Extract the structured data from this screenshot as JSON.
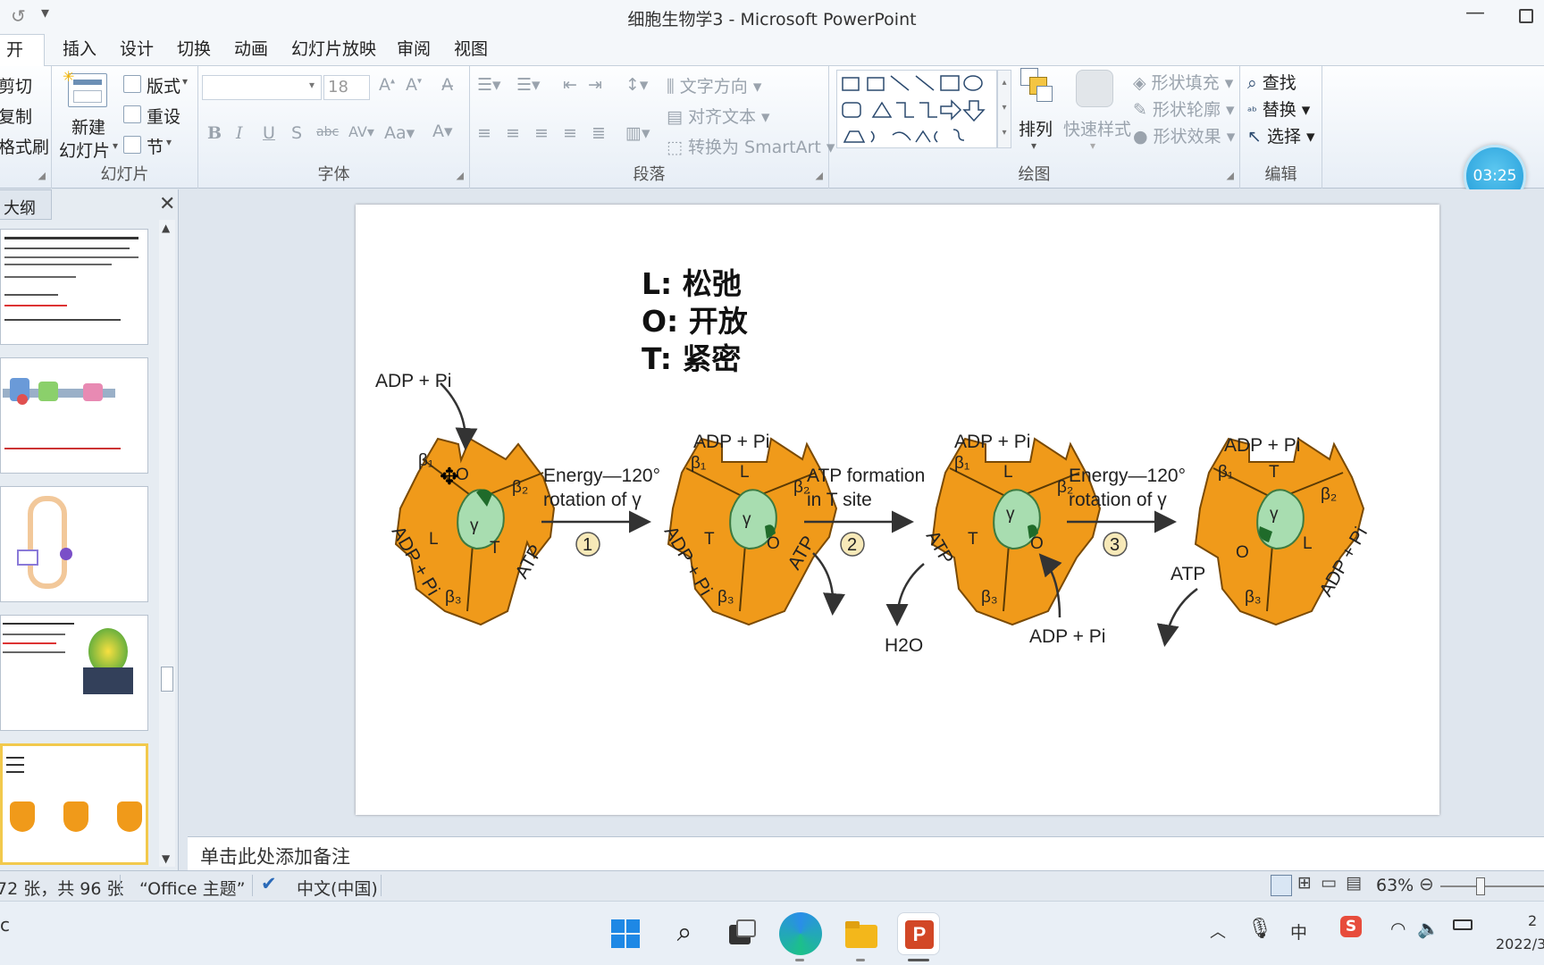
{
  "window": {
    "title": "细胞生物学3 - Microsoft PowerPoint"
  },
  "tabs": [
    "开始",
    "插入",
    "设计",
    "切换",
    "动画",
    "幻灯片放映",
    "审阅",
    "视图"
  ],
  "ribbon": {
    "clipboard": {
      "cut": "剪切",
      "copy": "复制",
      "format_painter": "格式刷"
    },
    "slides": {
      "new_slide_line1": "新建",
      "new_slide_line2": "幻灯片",
      "layout": "版式",
      "reset": "重设",
      "section": "节",
      "label": "幻灯片"
    },
    "font": {
      "font_size": "18",
      "label": "字体"
    },
    "paragraph": {
      "text_direction": "文字方向",
      "align_text": "对齐文本",
      "convert_smartart": "转换为 SmartArt",
      "label": "段落"
    },
    "drawing": {
      "arrange": "排列",
      "quick_styles": "快速样式",
      "shape_fill": "形状填充",
      "shape_outline": "形状轮廓",
      "shape_effects": "形状效果",
      "label": "绘图"
    },
    "editing": {
      "find": "查找",
      "replace": "替换",
      "select": "选择",
      "label": "编辑"
    }
  },
  "timer": "03:25",
  "outline_pane": {
    "tab": "大纲"
  },
  "slide": {
    "legend": [
      {
        "key": "L:",
        "value": "松弛"
      },
      {
        "key": "O:",
        "value": "开放"
      },
      {
        "key": "T:",
        "value": "紧密"
      }
    ],
    "diagram": {
      "input_label": "ADP + Pi",
      "step1": {
        "line1": "Energy—120°",
        "line2": "rotation of γ",
        "num": "1"
      },
      "step2": {
        "line1": "ATP formation",
        "line2": "in T site",
        "num": "2"
      },
      "step3": {
        "line1": "Energy—120°",
        "line2": "rotation of γ",
        "num": "3"
      },
      "water": "H2O",
      "adp_in": "ADP + Pi",
      "atp": "ATP"
    }
  },
  "notes_placeholder": "单击此处添加备注",
  "status": {
    "slide_count": "72 张，共 96 张",
    "theme": "“Office 主题”",
    "language": "中文(中国)",
    "zoom": "63%"
  },
  "taskbar": {
    "ime": "中",
    "time": "2",
    "date": "2022/3"
  }
}
